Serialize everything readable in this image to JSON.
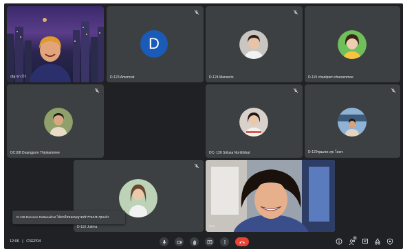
{
  "meeting": {
    "time": "12:06",
    "separator": "|",
    "code": "CSEP04"
  },
  "tiles": [
    {
      "name": "ณัฐ ชาวไร่"
    },
    {
      "name": "D-123 Amornrat",
      "initial": "D"
    },
    {
      "name": "D-124 Manserin"
    },
    {
      "name": "D-115 chanlporn charoenmee"
    },
    {
      "name": "DC108 Duangporn Thipkammee"
    },
    {
      "name": "DC- 126 Srilusa Noritthibat"
    },
    {
      "name": "D-129ชุฒเพล สุข โคตร"
    },
    {
      "name": "D-110 Jutima"
    },
    {
      "name": "คุณ"
    }
  ],
  "toast": {
    "text": "D-139 Darunee Rattanakhot ได้ยกมือขออนุญาตเข้าร่วมประชุมแล้ว"
  },
  "controls": {
    "badge_count": "9"
  },
  "colors": {
    "background": "#202124",
    "tile": "#3c4043",
    "avatar_blue": "#1a5bb7",
    "end_call": "#ea4335"
  },
  "icons": [
    "mic-icon",
    "camera-icon",
    "raise-hand-icon",
    "present-icon",
    "more-icon",
    "end-call-icon",
    "info-icon",
    "people-icon",
    "chat-icon",
    "activities-icon",
    "host-controls-icon",
    "pin-icon",
    "share-icon",
    "muted-mic-icon"
  ]
}
